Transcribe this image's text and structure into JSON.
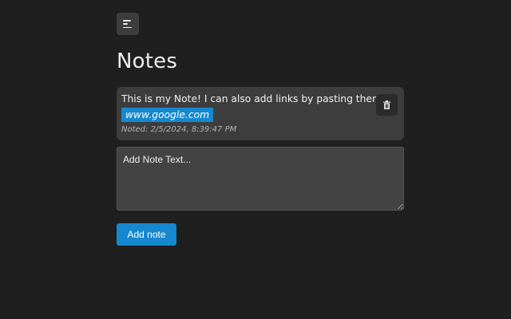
{
  "header": {
    "menu_icon": "menu-icon",
    "title": "Notes"
  },
  "notes": [
    {
      "text": "This is my Note! I can also add links by pasting them in:",
      "link": "www.google.com",
      "date": "Noted: 2/5/2024, 8:39:47 PM",
      "delete_icon": "trash-icon"
    }
  ],
  "composer": {
    "placeholder": "Add Note Text...",
    "value": "",
    "add_label": "Add note"
  },
  "colors": {
    "background": "#1f1f1f",
    "card": "#3d3d3d",
    "accent": "#1688cf",
    "input": "#434343"
  }
}
